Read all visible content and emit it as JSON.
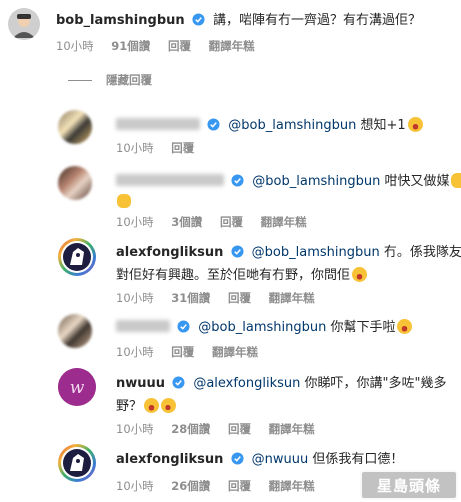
{
  "post": {
    "username": "bob_lamshingbun",
    "text": "講，啱陣有冇一齊過？有冇溝過佢？",
    "time": "10小時",
    "likes": "91個讚",
    "reply": "回覆",
    "translate": "翻譯年糕"
  },
  "hidden_replies": "隱藏回覆",
  "comments": [
    {
      "mention": "@bob_lamshingbun",
      "text": "想知+1",
      "time": "10小時",
      "reply": "回覆"
    },
    {
      "mention": "@bob_lamshingbun",
      "text": "咁快又做媒",
      "time": "10小時",
      "likes": "3個讚",
      "reply": "回覆",
      "translate": "翻譯年糕"
    },
    {
      "username": "alexfongliksun",
      "mention": "@bob_lamshingbun",
      "text_line1": "冇。係我隊友",
      "text_line2": "對佢好有興趣。至於佢哋有冇野，你問佢",
      "time": "10小時",
      "likes": "31個讚",
      "reply": "回覆",
      "translate": "翻譯年糕"
    },
    {
      "mention": "@bob_lamshingbun",
      "text": "你幫下手啦",
      "time": "10小時",
      "reply": "回覆",
      "translate": "翻譯年糕"
    },
    {
      "username": "nwuuu",
      "mention": "@alexfongliksun",
      "text_line1": "你睇吓，你講\"多咗\"幾多",
      "text_line2": "野？",
      "time": "10小時",
      "likes": "28個讚",
      "reply": "回覆",
      "translate": "翻譯年糕"
    },
    {
      "username": "alexfongliksun",
      "mention": "@nwuuu",
      "text": "但係我有口德！",
      "time": "10小時",
      "likes": "26個讚",
      "reply": "回覆",
      "translate": "翻譯年糕"
    }
  ],
  "watermark": "星島頭條",
  "colors": {
    "mention": "#00376b",
    "meta": "#8e8e8e",
    "verified": "#3897f0",
    "emoji": "#f7c236"
  }
}
